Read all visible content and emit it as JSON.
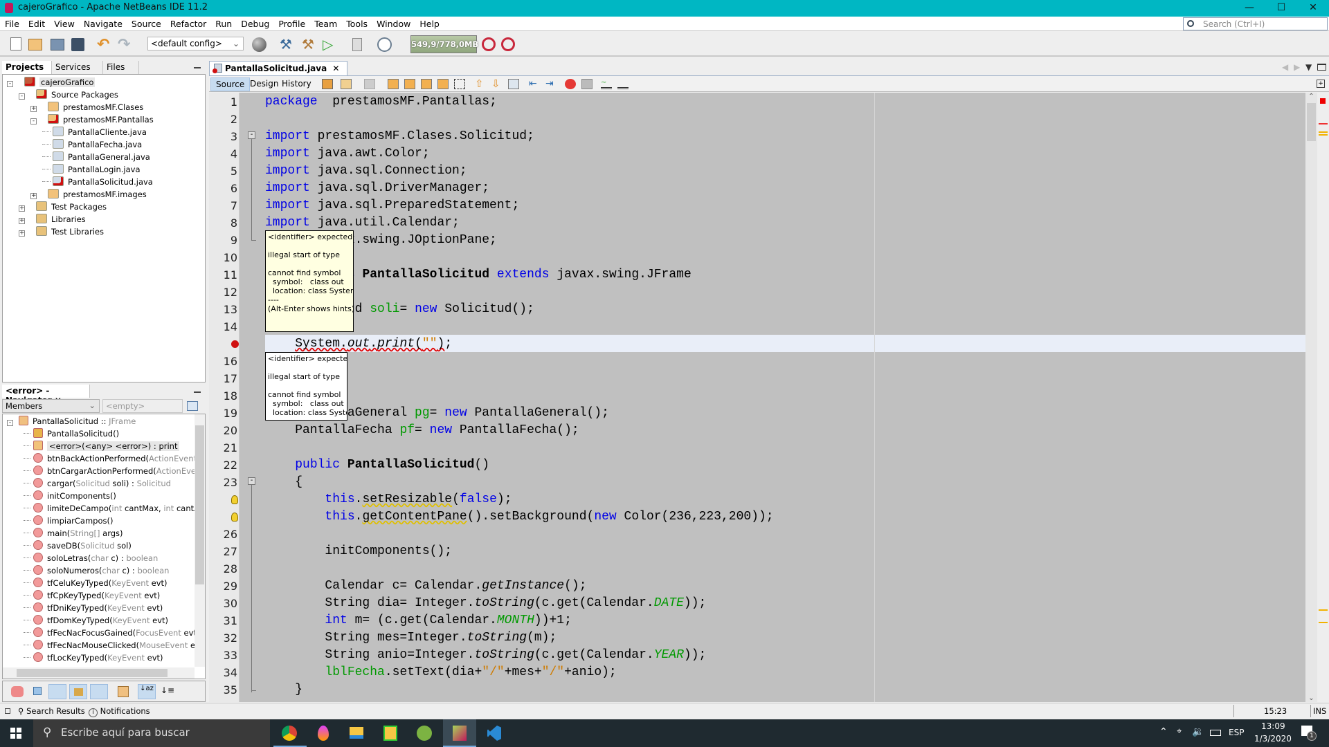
{
  "window": {
    "title": "cajeroGrafico - Apache NetBeans IDE 11.2",
    "accent": "#00b7c3"
  },
  "menu": [
    "File",
    "Edit",
    "View",
    "Navigate",
    "Source",
    "Refactor",
    "Run",
    "Debug",
    "Profile",
    "Team",
    "Tools",
    "Window",
    "Help"
  ],
  "search": {
    "placeholder": "Search (Ctrl+I)"
  },
  "toolbar": {
    "config": "<default config>",
    "memory": "549,9/778,0MB"
  },
  "projects_panel": {
    "tabs": [
      "Projects",
      "Services",
      "Files"
    ],
    "tree": [
      {
        "label": "cajeroGrafico",
        "level": 0,
        "exp": "-",
        "icon": "project-icon",
        "error": true,
        "selected": true
      },
      {
        "label": "Source Packages",
        "level": 1,
        "exp": "-",
        "icon": "source-packages-icon",
        "error": true
      },
      {
        "label": "prestamosMF.Clases",
        "level": 2,
        "exp": "+",
        "icon": "package-icon"
      },
      {
        "label": "prestamosMF.Pantallas",
        "level": 2,
        "exp": "-",
        "icon": "package-icon",
        "error": true
      },
      {
        "label": "PantallaCliente.java",
        "level": 3,
        "icon": "java-file-icon"
      },
      {
        "label": "PantallaFecha.java",
        "level": 3,
        "icon": "java-file-icon"
      },
      {
        "label": "PantallaGeneral.java",
        "level": 3,
        "icon": "java-file-icon"
      },
      {
        "label": "PantallaLogin.java",
        "level": 3,
        "icon": "java-file-icon"
      },
      {
        "label": "PantallaSolicitud.java",
        "level": 3,
        "icon": "java-file-icon",
        "error": true
      },
      {
        "label": "prestamosMF.images",
        "level": 2,
        "exp": "+",
        "icon": "package-icon"
      },
      {
        "label": "Test Packages",
        "level": 1,
        "exp": "+",
        "icon": "test-packages-icon"
      },
      {
        "label": "Libraries",
        "level": 1,
        "exp": "+",
        "icon": "libraries-icon"
      },
      {
        "label": "Test Libraries",
        "level": 1,
        "exp": "+",
        "icon": "test-libraries-icon"
      }
    ]
  },
  "navigator": {
    "title": "<error> - Navigator",
    "filter": "Members",
    "empty": "<empty>",
    "items": [
      {
        "parts": [
          [
            "PantallaSolicitud :: ",
            0
          ],
          [
            "JFrame",
            1
          ]
        ],
        "level": 0,
        "icon": "class-icon"
      },
      {
        "parts": [
          [
            "PantallaSolicitud()",
            0
          ]
        ],
        "level": 1,
        "icon": "constructor-icon"
      },
      {
        "parts": [
          [
            "<error>(<any> <error>) : print",
            0
          ]
        ],
        "level": 1,
        "icon": "field-error-icon",
        "selected": true
      },
      {
        "parts": [
          [
            "btnBackActionPerformed(",
            0
          ],
          [
            "ActionEvent",
            1
          ],
          [
            " evt)",
            0
          ]
        ],
        "level": 1,
        "icon": "private-method-icon"
      },
      {
        "parts": [
          [
            "btnCargarActionPerformed(",
            0
          ],
          [
            "ActionEvent",
            1
          ],
          [
            " evt)",
            0
          ]
        ],
        "level": 1,
        "icon": "private-method-icon"
      },
      {
        "parts": [
          [
            "cargar(",
            0
          ],
          [
            "Solicitud",
            1
          ],
          [
            " soli) : ",
            0
          ],
          [
            "Solicitud",
            1
          ]
        ],
        "level": 1,
        "icon": "method-icon"
      },
      {
        "parts": [
          [
            "initComponents()",
            0
          ]
        ],
        "level": 1,
        "icon": "private-method-icon"
      },
      {
        "parts": [
          [
            "limiteDeCampo(",
            0
          ],
          [
            "int",
            1
          ],
          [
            " cantMax, ",
            0
          ],
          [
            "int",
            1
          ],
          [
            " cantAc) : bo",
            0
          ]
        ],
        "level": 1,
        "icon": "method-icon"
      },
      {
        "parts": [
          [
            "limpiarCampos()",
            0
          ]
        ],
        "level": 1,
        "icon": "method-icon"
      },
      {
        "parts": [
          [
            "main(",
            0
          ],
          [
            "String[]",
            1
          ],
          [
            " args)",
            0
          ]
        ],
        "level": 1,
        "icon": "static-method-icon"
      },
      {
        "parts": [
          [
            "saveDB(",
            0
          ],
          [
            "Solicitud",
            1
          ],
          [
            " sol)",
            0
          ]
        ],
        "level": 1,
        "icon": "method-icon"
      },
      {
        "parts": [
          [
            "soloLetras(",
            0
          ],
          [
            "char",
            1
          ],
          [
            " c) : ",
            0
          ],
          [
            "boolean",
            1
          ]
        ],
        "level": 1,
        "icon": "method-icon"
      },
      {
        "parts": [
          [
            "soloNumeros(",
            0
          ],
          [
            "char",
            1
          ],
          [
            " c) : ",
            0
          ],
          [
            "boolean",
            1
          ]
        ],
        "level": 1,
        "icon": "method-icon"
      },
      {
        "parts": [
          [
            "tfCeluKeyTyped(",
            0
          ],
          [
            "KeyEvent",
            1
          ],
          [
            " evt)",
            0
          ]
        ],
        "level": 1,
        "icon": "private-method-icon"
      },
      {
        "parts": [
          [
            "tfCpKeyTyped(",
            0
          ],
          [
            "KeyEvent",
            1
          ],
          [
            " evt)",
            0
          ]
        ],
        "level": 1,
        "icon": "private-method-icon"
      },
      {
        "parts": [
          [
            "tfDniKeyTyped(",
            0
          ],
          [
            "KeyEvent",
            1
          ],
          [
            " evt)",
            0
          ]
        ],
        "level": 1,
        "icon": "private-method-icon"
      },
      {
        "parts": [
          [
            "tfDomKeyTyped(",
            0
          ],
          [
            "KeyEvent",
            1
          ],
          [
            " evt)",
            0
          ]
        ],
        "level": 1,
        "icon": "private-method-icon"
      },
      {
        "parts": [
          [
            "tfFecNacFocusGained(",
            0
          ],
          [
            "FocusEvent",
            1
          ],
          [
            " evt)",
            0
          ]
        ],
        "level": 1,
        "icon": "private-method-icon"
      },
      {
        "parts": [
          [
            "tfFecNacMouseClicked(",
            0
          ],
          [
            "MouseEvent",
            1
          ],
          [
            " evt)",
            0
          ]
        ],
        "level": 1,
        "icon": "private-method-icon"
      },
      {
        "parts": [
          [
            "tfLocKeyTyped(",
            0
          ],
          [
            "KeyEvent",
            1
          ],
          [
            " evt)",
            0
          ]
        ],
        "level": 1,
        "icon": "private-method-icon"
      }
    ]
  },
  "editor": {
    "tab": "PantallaSolicitud.java",
    "views": [
      "Source",
      "Design",
      "History"
    ],
    "lines": [
      {
        "n": "1",
        "t": [
          [
            "k",
            "package"
          ],
          [
            "",
            "  prestamosMF.Pantallas;"
          ]
        ]
      },
      {
        "n": "2",
        "t": []
      },
      {
        "n": "3",
        "t": [
          [
            "k",
            "import"
          ],
          [
            "",
            " prestamosMF.Clases.Solicitud;"
          ]
        ]
      },
      {
        "n": "4",
        "t": [
          [
            "k",
            "import"
          ],
          [
            "",
            " java.awt.Color;"
          ]
        ]
      },
      {
        "n": "5",
        "t": [
          [
            "k",
            "import"
          ],
          [
            "",
            " java.sql.Connection;"
          ]
        ]
      },
      {
        "n": "6",
        "t": [
          [
            "k",
            "import"
          ],
          [
            "",
            " java.sql.DriverManager;"
          ]
        ]
      },
      {
        "n": "7",
        "t": [
          [
            "k",
            "import"
          ],
          [
            "",
            " java.sql.PreparedStatement;"
          ]
        ]
      },
      {
        "n": "8",
        "t": [
          [
            "k",
            "import"
          ],
          [
            "",
            " java.util.Calendar;"
          ]
        ]
      },
      {
        "n": "9",
        "t": [
          [
            "k",
            "import"
          ],
          [
            "",
            " javax.swing.JOptionPane;"
          ]
        ]
      },
      {
        "n": "10",
        "t": []
      },
      {
        "n": "11",
        "t": [
          [
            "k",
            "public class"
          ],
          [
            "",
            " "
          ],
          [
            "b",
            "PantallaSolicitud"
          ],
          [
            "",
            " "
          ],
          [
            "k",
            "extends"
          ],
          [
            "",
            " javax.swing.JFrame"
          ]
        ]
      },
      {
        "n": "12",
        "t": []
      },
      {
        "n": "13",
        "t": [
          [
            "",
            "    Solicitud "
          ],
          [
            "f",
            "soli"
          ],
          [
            "",
            "= "
          ],
          [
            "k",
            "new"
          ],
          [
            "",
            " Solicitud();"
          ]
        ]
      },
      {
        "n": "14",
        "t": []
      },
      {
        "n": "",
        "err": true,
        "t": [
          [
            "",
            "    "
          ],
          [
            "err",
            "System."
          ],
          [
            "err i",
            "out"
          ],
          [
            "err",
            "."
          ],
          [
            "err i",
            "print"
          ],
          [
            "err",
            "("
          ],
          [
            "err s",
            "\"\""
          ],
          [
            "err",
            ")"
          ],
          [
            "",
            ";"
          ]
        ]
      },
      {
        "n": "16",
        "t": []
      },
      {
        "n": "17",
        "t": []
      },
      {
        "n": "18",
        "t": []
      },
      {
        "n": "19",
        "t": [
          [
            "",
            "    PantallaGeneral "
          ],
          [
            "f",
            "pg"
          ],
          [
            "",
            "= "
          ],
          [
            "k",
            "new"
          ],
          [
            "",
            " PantallaGeneral();"
          ]
        ]
      },
      {
        "n": "20",
        "t": [
          [
            "",
            "    PantallaFecha "
          ],
          [
            "f",
            "pf"
          ],
          [
            "",
            "= "
          ],
          [
            "k",
            "new"
          ],
          [
            "",
            " PantallaFecha();"
          ]
        ]
      },
      {
        "n": "21",
        "t": []
      },
      {
        "n": "22",
        "t": [
          [
            "",
            "    "
          ],
          [
            "k",
            "public"
          ],
          [
            "",
            " "
          ],
          [
            "b",
            "PantallaSolicitud"
          ],
          [
            "",
            "()"
          ]
        ]
      },
      {
        "n": "23",
        "t": [
          [
            "",
            "    {"
          ]
        ]
      },
      {
        "n": "",
        "warn": true,
        "t": [
          [
            "",
            "        "
          ],
          [
            "k",
            "this"
          ],
          [
            "",
            "."
          ],
          [
            "warn",
            "setResizable"
          ],
          [
            "",
            "("
          ],
          [
            "k",
            "false"
          ],
          [
            "",
            ");"
          ]
        ]
      },
      {
        "n": "",
        "warn": true,
        "t": [
          [
            "",
            "        "
          ],
          [
            "k",
            "this"
          ],
          [
            "",
            "."
          ],
          [
            "warn",
            "getContentPane"
          ],
          [
            "",
            "().setBackground("
          ],
          [
            "k",
            "new"
          ],
          [
            "",
            " Color(236,223,200));"
          ]
        ]
      },
      {
        "n": "26",
        "t": []
      },
      {
        "n": "27",
        "t": [
          [
            "",
            "        initComponents();"
          ]
        ]
      },
      {
        "n": "28",
        "t": []
      },
      {
        "n": "29",
        "t": [
          [
            "",
            "        Calendar c= Calendar."
          ],
          [
            "i",
            "getInstance"
          ],
          [
            "",
            "();"
          ]
        ]
      },
      {
        "n": "30",
        "t": [
          [
            "",
            "        String dia= Integer."
          ],
          [
            "i",
            "toString"
          ],
          [
            "",
            "(c.get(Calendar."
          ],
          [
            "fi",
            "DATE"
          ],
          [
            "",
            "));"
          ]
        ]
      },
      {
        "n": "31",
        "t": [
          [
            "",
            "        "
          ],
          [
            "k",
            "int"
          ],
          [
            "",
            " m= (c.get(Calendar."
          ],
          [
            "fi",
            "MONTH"
          ],
          [
            "",
            "))+1;"
          ]
        ]
      },
      {
        "n": "32",
        "t": [
          [
            "",
            "        String mes=Integer."
          ],
          [
            "i",
            "toString"
          ],
          [
            "",
            "(m);"
          ]
        ]
      },
      {
        "n": "33",
        "t": [
          [
            "",
            "        String anio=Integer."
          ],
          [
            "i",
            "toString"
          ],
          [
            "",
            "(c.get(Calendar."
          ],
          [
            "fi",
            "YEAR"
          ],
          [
            "",
            "));"
          ]
        ]
      },
      {
        "n": "34",
        "t": [
          [
            "",
            "        "
          ],
          [
            "f",
            "lblFecha"
          ],
          [
            "",
            ".setText(dia+"
          ],
          [
            "s",
            "\"/\""
          ],
          [
            "",
            "+mes+"
          ],
          [
            "s",
            "\"/\""
          ],
          [
            "",
            "+anio);"
          ]
        ]
      },
      {
        "n": "35",
        "t": [
          [
            "",
            "    }"
          ]
        ]
      }
    ],
    "tooltip1": "<identifier> expected\n\nillegal start of type\n\ncannot find symbol\n  symbol:   class out\n  location: class System\n----\n(Alt-Enter shows hints)",
    "tooltip2": "<identifier> expected\n\nillegal start of type\n\ncannot find symbol\n  symbol:   class out\n  location: class System"
  },
  "statusbar": {
    "search_results": "Search Results",
    "notifications": "Notifications",
    "position": "15:23",
    "mode": "INS"
  },
  "taskbar": {
    "search_placeholder": "Escribe aquí para buscar",
    "lang": "ESP",
    "time": "13:09",
    "date": "1/3/2020",
    "notif_count": "1",
    "apps": [
      "chrome-icon",
      "paint3d-icon",
      "file-explorer-icon",
      "xampp-icon",
      "android-studio-icon",
      "netbeans-icon",
      "vscode-icon"
    ]
  }
}
